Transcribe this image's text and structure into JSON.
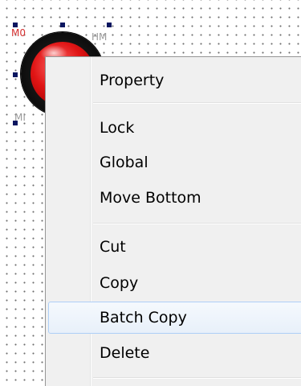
{
  "widget": {
    "name_label": "M0",
    "right_label": "HM",
    "bottom_label": "MI"
  },
  "context_menu": {
    "groups": [
      [
        "Property"
      ],
      [
        "Lock",
        "Global",
        "Move Bottom"
      ],
      [
        "Cut",
        "Copy",
        "Batch Copy",
        "Delete"
      ]
    ],
    "items": {
      "property": "Property",
      "lock": "Lock",
      "global": "Global",
      "move_bottom": "Move Bottom",
      "cut": "Cut",
      "copy": "Copy",
      "batch_copy": "Batch Copy",
      "delete": "Delete"
    },
    "highlighted_item": "Batch Copy"
  },
  "colors": {
    "grid_dot": "#6e6e6e",
    "handle": "#0b1660",
    "lamp_red": "#e01515",
    "label_red": "#d63030",
    "menu_bg": "#f0f0f0",
    "menu_highlight_border": "#aecff7"
  }
}
